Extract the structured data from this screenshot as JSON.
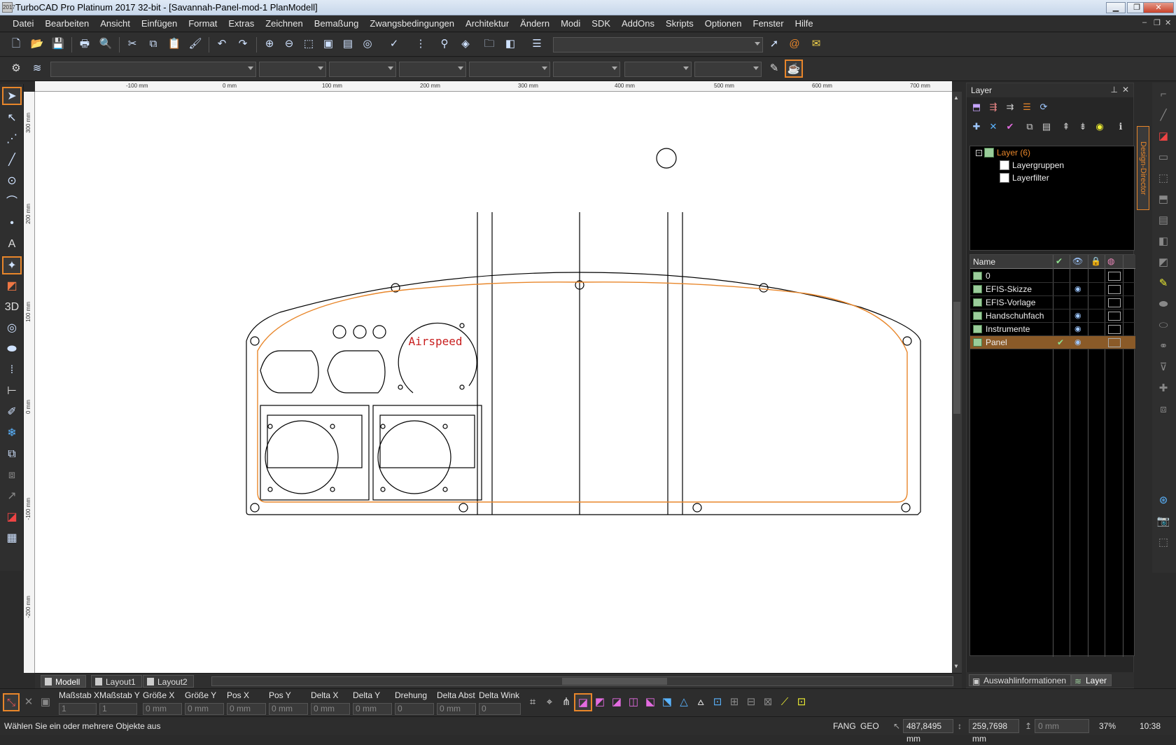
{
  "window": {
    "title": "TurboCAD Pro Platinum 2017 32-bit - [Savannah-Panel-mod-1 PlanModell]",
    "app_icon_text": "2017"
  },
  "menu": [
    "Datei",
    "Bearbeiten",
    "Ansicht",
    "Einfügen",
    "Format",
    "Extras",
    "Zeichnen",
    "Bemaßung",
    "Zwangsbedingungen",
    "Architektur",
    "Ändern",
    "Modi",
    "SDK",
    "AddOns",
    "Skripts",
    "Optionen",
    "Fenster",
    "Hilfe"
  ],
  "ruler": {
    "h_labels": [
      "-100 mm",
      "0 mm",
      "100 mm",
      "200 mm",
      "300 mm",
      "400 mm",
      "500 mm",
      "600 mm",
      "700 mm"
    ],
    "v_labels": [
      "300 mm",
      "200 mm",
      "100 mm",
      "0 mm",
      "-100 mm",
      "-200 mm"
    ]
  },
  "drawing": {
    "airspeed_label": "Airspeed"
  },
  "layout_tabs": [
    "Modell",
    "Layout1",
    "Layout2"
  ],
  "layer_panel": {
    "title": "Layer",
    "design_director": "Design-Director",
    "tree": {
      "root": "Layer (6)",
      "children": [
        "Layergruppen",
        "Layerfilter"
      ]
    },
    "table_header": "Name",
    "layers": [
      {
        "name": "0",
        "active": false,
        "visible": false,
        "selected": false
      },
      {
        "name": "EFIS-Skizze",
        "active": false,
        "visible": true,
        "selected": false
      },
      {
        "name": "EFIS-Vorlage",
        "active": false,
        "visible": false,
        "selected": false
      },
      {
        "name": "Handschuhfach",
        "active": false,
        "visible": true,
        "selected": false
      },
      {
        "name": "Instrumente",
        "active": false,
        "visible": true,
        "selected": false
      },
      {
        "name": "Panel",
        "active": true,
        "visible": true,
        "selected": true
      }
    ],
    "bottom_tabs": [
      "Auswahlinformationen",
      "Layer"
    ]
  },
  "properties": {
    "fields": [
      {
        "label": "Maßstab X",
        "value": "1"
      },
      {
        "label": "Maßstab Y",
        "value": "1"
      },
      {
        "label": "Größe X",
        "value": "0 mm"
      },
      {
        "label": "Größe Y",
        "value": "0 mm"
      },
      {
        "label": "Pos X",
        "value": "0 mm"
      },
      {
        "label": "Pos Y",
        "value": "0 mm"
      },
      {
        "label": "Delta X",
        "value": "0 mm"
      },
      {
        "label": "Delta Y",
        "value": "0 mm"
      },
      {
        "label": "Drehung",
        "value": "0"
      },
      {
        "label": "Delta Abst",
        "value": "0 mm"
      },
      {
        "label": "Delta Wink",
        "value": "0"
      }
    ]
  },
  "status": {
    "message": "Wählen Sie ein oder mehrere Objekte aus",
    "fang": "FANG",
    "geo": "GEO",
    "x": "487,8495 mm",
    "y": "259,7698 mm",
    "z": "0 mm",
    "zoom": "37%",
    "time": "10:38"
  }
}
